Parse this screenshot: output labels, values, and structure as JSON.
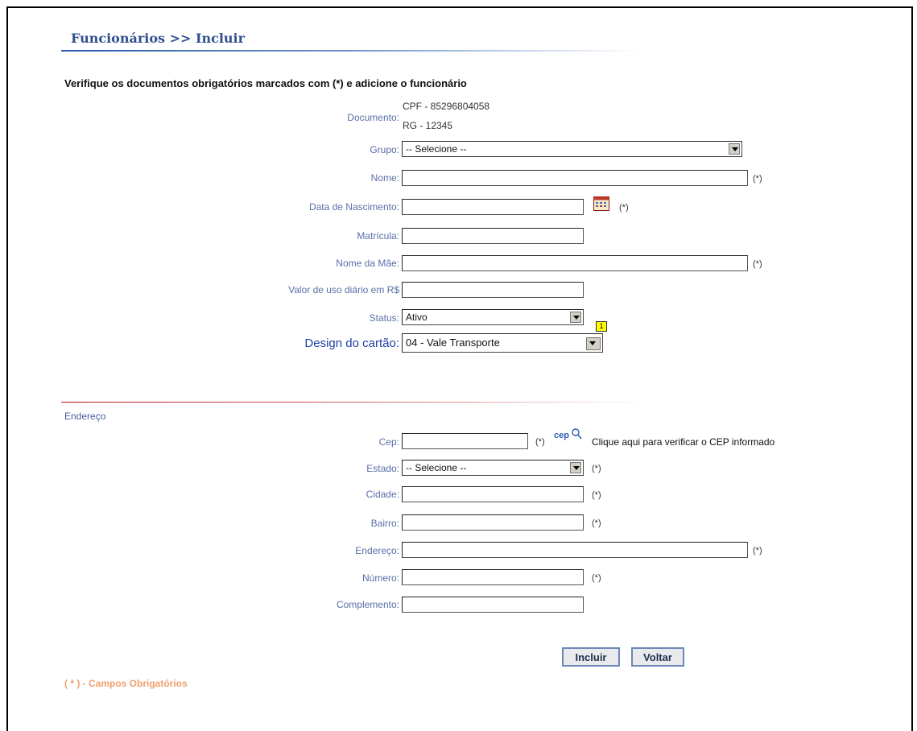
{
  "header": {
    "title": "Funcionários  >> Incluir"
  },
  "intro": "Verifique os documentos obrigatórios marcados com (*) e adicione o funcionário",
  "documento": {
    "label": "Documento:",
    "cpf": "CPF - 85296804058",
    "rg": "RG - 12345"
  },
  "required_mark": "(*)",
  "fields": {
    "grupo": {
      "label": "Grupo:",
      "value": "-- Selecione --"
    },
    "nome": {
      "label": "Nome:",
      "value": ""
    },
    "nascimento": {
      "label": "Data de Nascimento:",
      "value": ""
    },
    "matricula": {
      "label": "Matrícula:",
      "value": ""
    },
    "nome_mae": {
      "label": "Nome da Mãe:",
      "value": ""
    },
    "valor": {
      "label": "Valor de uso diário em R$",
      "value": ""
    },
    "status": {
      "label": "Status:",
      "value": "Ativo"
    },
    "design": {
      "label": "Design do cartão:",
      "value": "04 - Vale Transporte",
      "badge": "1"
    }
  },
  "endereco_section": {
    "title": "Endereço",
    "cep": {
      "label": "Cep:",
      "value": "",
      "link": "Clique aqui para verificar o CEP informado",
      "logo": "cep"
    },
    "estado": {
      "label": "Estado:",
      "value": "-- Selecione --"
    },
    "cidade": {
      "label": "Cidade:",
      "value": ""
    },
    "bairro": {
      "label": "Bairro:",
      "value": ""
    },
    "endereco": {
      "label": "Endereço:",
      "value": ""
    },
    "numero": {
      "label": "Número:",
      "value": ""
    },
    "complemento": {
      "label": "Complemento:",
      "value": ""
    }
  },
  "buttons": {
    "incluir": "Incluir",
    "voltar": "Voltar"
  },
  "footnote": "( * ) - Campos Obrigatórios",
  "icons": {
    "calendar": "calendar-icon",
    "cep_search": "cep-search-icon"
  },
  "colors": {
    "label": "#5a6fa8",
    "title": "#2f4f8f",
    "footnote": "#f0a070",
    "divider": "#b01010"
  }
}
